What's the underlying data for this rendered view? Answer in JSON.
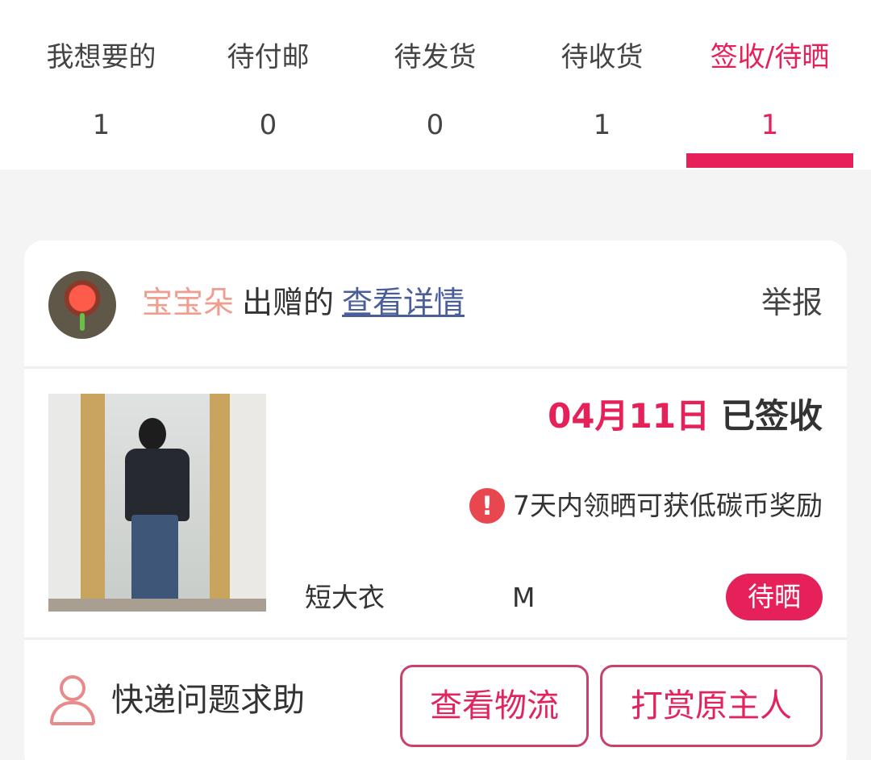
{
  "tabs": [
    {
      "label": "我想要的",
      "count": "1",
      "active": false
    },
    {
      "label": "待付邮",
      "count": "0",
      "active": false
    },
    {
      "label": "待发货",
      "count": "0",
      "active": false
    },
    {
      "label": "待收货",
      "count": "1",
      "active": false
    },
    {
      "label": "签收/待晒",
      "count": "1",
      "active": true
    }
  ],
  "card": {
    "donor_name": "宝宝朵",
    "gift_text": "出赠的",
    "details_link": "查看详情",
    "report_label": "举报",
    "date": "04月11日",
    "status": "已签收",
    "reward_text": "7天内领晒可获低碳币奖励",
    "warn_symbol": "!",
    "item_name": "短大衣",
    "item_size": "M",
    "badge_label": "待晒",
    "help_label": "快递问题求助",
    "logistics_button": "查看物流",
    "tip_button": "打赏原主人"
  },
  "colors": {
    "accent": "#e6215a",
    "donor": "#f09c8e",
    "link": "#4a5f9a",
    "warn": "#e8474f"
  },
  "icons": {
    "avatar": "rose-avatar",
    "warning": "exclamation-circle-icon",
    "help": "person-icon"
  }
}
